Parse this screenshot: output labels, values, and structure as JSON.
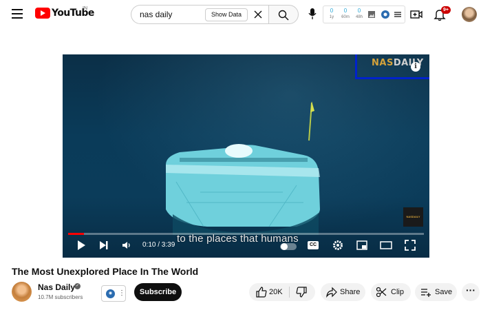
{
  "header": {
    "logo_text": "YouTube",
    "country": "IN",
    "search_value": "nas daily",
    "show_data_label": "Show Data",
    "notification_count": "9+"
  },
  "extension": {
    "stats": [
      {
        "value": "0",
        "unit": "1y"
      },
      {
        "value": "0",
        "unit": "60m"
      },
      {
        "value": "0",
        "unit": "48h"
      }
    ]
  },
  "player": {
    "brand_part1": "NAS",
    "brand_part2": "DAILY",
    "info_label": "i",
    "corner_logo": "NASDAILY",
    "subtitle": "to the places that humans",
    "time": "0:10 / 3:39",
    "progress": 0.045,
    "cc_label": "CC"
  },
  "video": {
    "title": "The Most Unexplored Place In The World",
    "channel": "Nas Daily",
    "subscribers": "10.7M subscribers",
    "subscribe_label": "Subscribe",
    "likes": "20K",
    "share_label": "Share",
    "clip_label": "Clip",
    "save_label": "Save"
  },
  "colors": {
    "youtube_red": "#ff0000",
    "highlight_box": "#0022cc",
    "brand_gold": "#d4a23a",
    "stat_blue": "#2aa7d6"
  }
}
